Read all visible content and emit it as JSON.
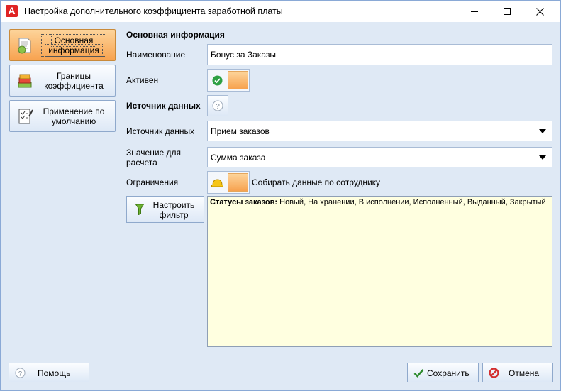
{
  "window": {
    "title": "Настройка дополнительного коэффициента заработной платы",
    "app_icon_letter": "A"
  },
  "nav": {
    "items": [
      {
        "line1": "Основная",
        "line2": "информация",
        "active": true,
        "icon": "document-icon"
      },
      {
        "line1": "Границы",
        "line2": "коэффициента",
        "active": false,
        "icon": "stack-icon"
      },
      {
        "line1": "Применение по",
        "line2": "умолчанию",
        "active": false,
        "icon": "checklist-icon"
      }
    ]
  },
  "form": {
    "section_title": "Основная информация",
    "name_label": "Наименование",
    "name_value": "Бонус за Заказы",
    "active_label": "Активен",
    "datasource_heading": "Источник данных",
    "datasource_label": "Источник данных",
    "datasource_value": "Прием заказов",
    "calc_label_line1": "Значение для",
    "calc_label_line2": "расчета",
    "calc_value": "Сумма заказа",
    "limits_label": "Ограничения",
    "limits_toggle_text": "Собирать данные по сотруднику",
    "filter_button_line1": "Настроить",
    "filter_button_line2": "фильтр",
    "status_bold": "Статусы заказов:",
    "status_text": " Новый, На хранении, В исполнении, Исполненный, Выданный, Закрытый"
  },
  "footer": {
    "help_label": "Помощь",
    "save_label": "Сохранить",
    "cancel_label": "Отмена"
  },
  "colors": {
    "accent_orange": "#f7a24f",
    "panel_bg": "#dfe9f5",
    "status_bg": "#ffffe0"
  }
}
